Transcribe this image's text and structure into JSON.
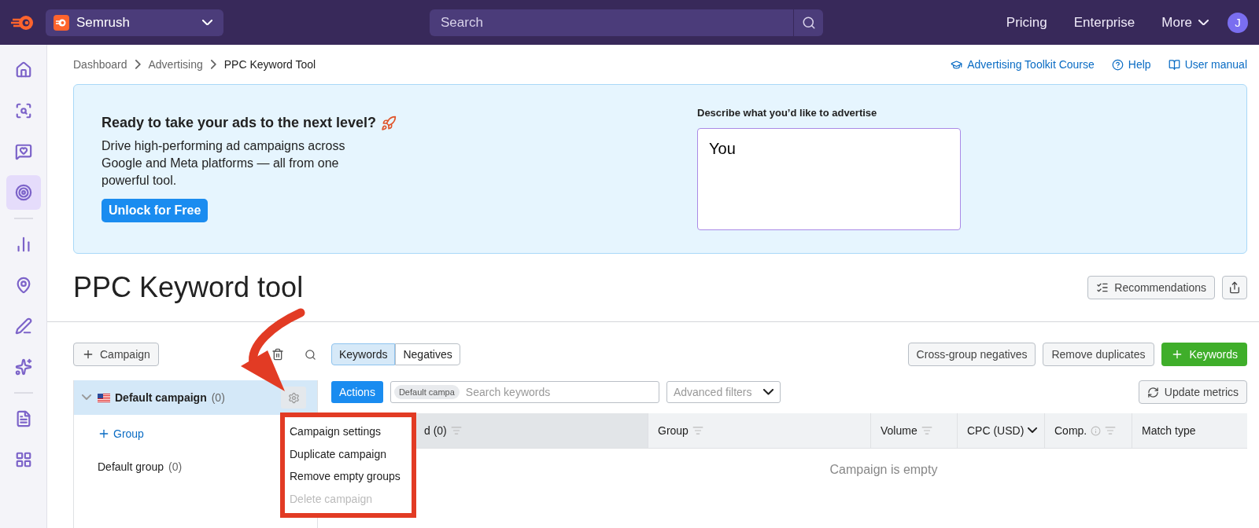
{
  "topbar": {
    "project": "Semrush",
    "search": {
      "placeholder": "Search"
    },
    "links": [
      "Pricing",
      "Enterprise"
    ],
    "more": "More",
    "avatar": "J"
  },
  "sidebar": {
    "groups": [
      [
        {
          "selected": false
        },
        {
          "selected": false
        },
        {
          "selected": false
        },
        {
          "selected": true
        }
      ],
      [
        {
          "selected": false
        },
        {
          "selected": false
        },
        {
          "selected": false
        },
        {
          "selected": false
        }
      ],
      [
        {
          "selected": false
        },
        {
          "selected": false
        }
      ]
    ]
  },
  "breadcrumb": [
    "Dashboard",
    "Advertising",
    "PPC Keyword Tool"
  ],
  "help_links": [
    {
      "kind": "course",
      "label": "Advertising Toolkit Course"
    },
    {
      "kind": "help",
      "label": "Help"
    },
    {
      "kind": "manual",
      "label": "User manual"
    }
  ],
  "banner": {
    "heading": "Ready to take your ads to the next level?",
    "text": "Drive high-performing ad campaigns across Google and Meta platforms — all from one powerful tool.",
    "button": "Unlock for Free",
    "field_label": "Describe what you’d like to advertise",
    "field_value": "You"
  },
  "title": "PPC Keyword tool",
  "header_buttons": {
    "recommendations": "Recommendations"
  },
  "campaign_panel": {
    "add_button": "Campaign",
    "campaigns": [
      {
        "name": "Default campaign",
        "count": "(0)",
        "expanded": true,
        "selected": true,
        "add_group": "Group",
        "groups": [
          {
            "name": "Default group",
            "count": "(0)"
          }
        ]
      }
    ]
  },
  "menu": [
    {
      "label": "Campaign settings",
      "disabled": false
    },
    {
      "label": "Duplicate campaign",
      "disabled": false
    },
    {
      "label": "Remove empty groups",
      "disabled": false
    },
    {
      "label": "Delete campaign",
      "disabled": true
    }
  ],
  "tabs": [
    {
      "label": "Keywords",
      "selected": true
    },
    {
      "label": "Negatives",
      "selected": false
    }
  ],
  "right_buttons": [
    {
      "kind": "outline",
      "label": "Cross-group negatives"
    },
    {
      "kind": "outline",
      "label": "Remove duplicates"
    },
    {
      "kind": "primary",
      "label": "Keywords"
    }
  ],
  "filters": {
    "actions": "Actions",
    "chip": "Default campa",
    "search_placeholder": "Search keywords",
    "advanced": "Advanced filters",
    "update": "Update metrics"
  },
  "table": {
    "columns": [
      {
        "label": "d (0)",
        "kind": "sortable",
        "info": false,
        "active": true
      },
      {
        "label": "Group",
        "kind": "sortable",
        "info": false,
        "active": false
      },
      {
        "label": "Volume",
        "kind": "sortable",
        "info": false,
        "active": false
      },
      {
        "label": "CPC (USD)",
        "kind": "dropdown",
        "info": false,
        "active": false
      },
      {
        "label": "Comp.",
        "kind": "sortable",
        "info": true,
        "active": false
      },
      {
        "label": "Match type",
        "kind": "plain",
        "info": false,
        "active": false
      }
    ],
    "empty": "Campaign is empty"
  }
}
